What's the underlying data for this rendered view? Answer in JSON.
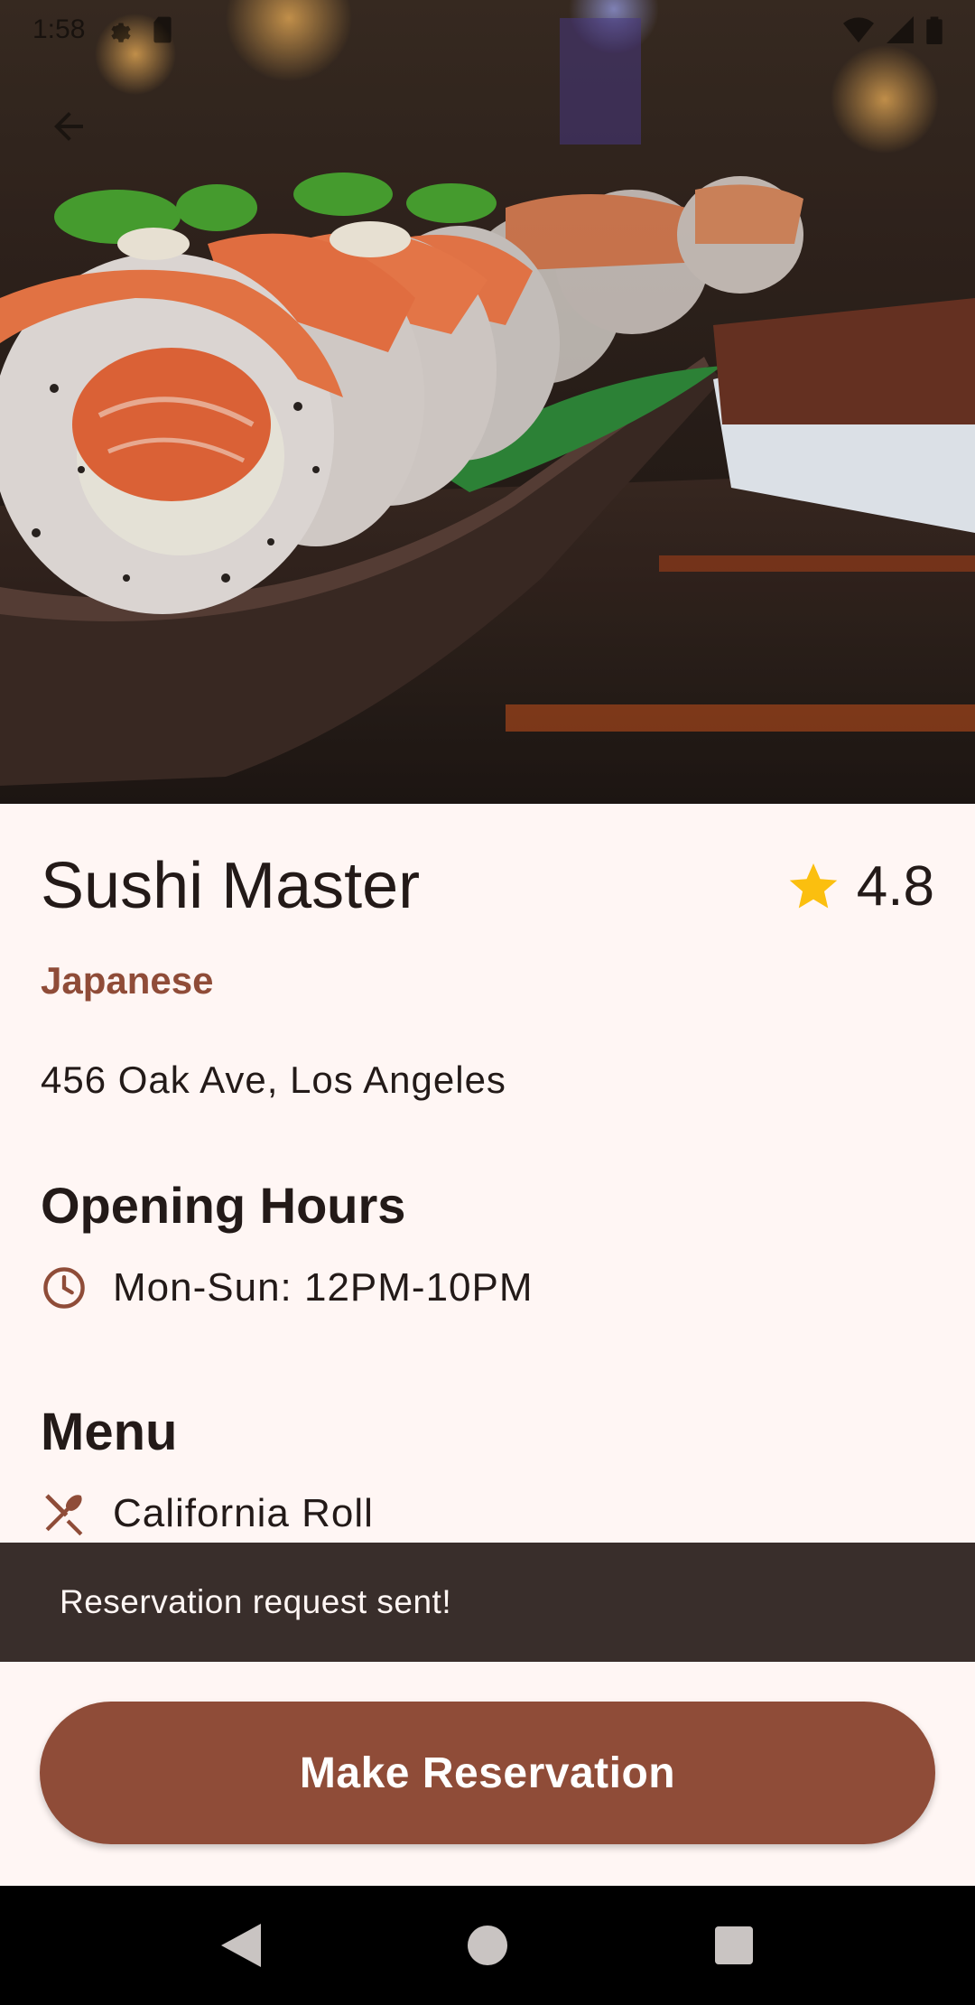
{
  "status_bar": {
    "time": "1:58"
  },
  "restaurant": {
    "name": "Sushi Master",
    "rating": "4.8",
    "cuisine": "Japanese",
    "address": "456 Oak Ave, Los Angeles"
  },
  "hours": {
    "heading": "Opening Hours",
    "text": "Mon-Sun: 12PM-10PM"
  },
  "menu": {
    "heading": "Menu",
    "items": [
      "California Roll"
    ]
  },
  "snackbar": {
    "message": "Reservation request sent!"
  },
  "actions": {
    "reserve_label": "Make Reservation"
  },
  "colors": {
    "accent": "#8f4c38",
    "background": "#fff6f4",
    "snackbar": "#392e2b",
    "star": "#fbbf0f"
  },
  "icons": {
    "back": "arrow-back-icon",
    "star": "star-icon",
    "clock": "clock-icon",
    "menu_item": "utensils-icon"
  }
}
